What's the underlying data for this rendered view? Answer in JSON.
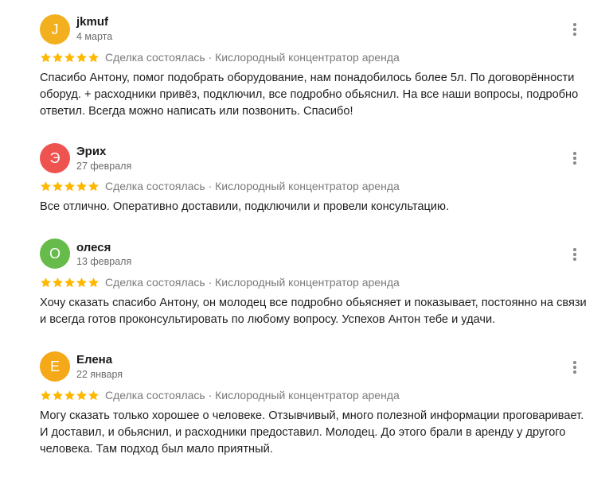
{
  "reviews": [
    {
      "initial": "J",
      "avatar_color": "#f2b01e",
      "author": "jkmuf",
      "date": "4 марта",
      "rating": 5,
      "meta": "Сделка состоялась · Кислородный концентратор аренда",
      "text": "Спасибо Антону, помог подобрать оборудование, нам понадобилось более 5л. По договорённости оборуд. + расходники привёз, подключил, все подробно обьяснил. На все наши вопросы, подробно ответил. Всегда можно написать или позвонить. Спасибо!"
    },
    {
      "initial": "Э",
      "avatar_color": "#ef5350",
      "author": "Эрих",
      "date": "27 февраля",
      "rating": 5,
      "meta": "Сделка состоялась · Кислородный концентратор аренда",
      "text": "Все отлично. Оперативно доставили, подключили и провели консультацию."
    },
    {
      "initial": "О",
      "avatar_color": "#66bb4a",
      "author": "олеся",
      "date": "13 февраля",
      "rating": 5,
      "meta": "Сделка состоялась · Кислородный концентратор аренда",
      "text": "Хочу сказать спасибо Антону, он молодец все подробно обьясняет и показывает, постоянно на связи и всегда готов проконсультировать по любому вопросу. Успехов Антон тебе и удачи."
    },
    {
      "initial": "Е",
      "avatar_color": "#f5a818",
      "author": "Елена",
      "date": "22 января",
      "rating": 5,
      "meta": "Сделка состоялась · Кислородный концентратор аренда",
      "text": "Могу сказать только хорошее о человеке. Отзывчивый, много полезной информации проговаривает. И доставил, и обьяснил, и расходники предоставил. Молодец. До этого брали в аренду у другого человека. Там подход был мало приятный."
    }
  ],
  "colors": {
    "star": "#ffb800",
    "meta_text": "#7a7a7a",
    "date_text": "#6b6b6b"
  },
  "icons": {
    "rating": "star-icon",
    "menu": "more-vertical-icon"
  }
}
